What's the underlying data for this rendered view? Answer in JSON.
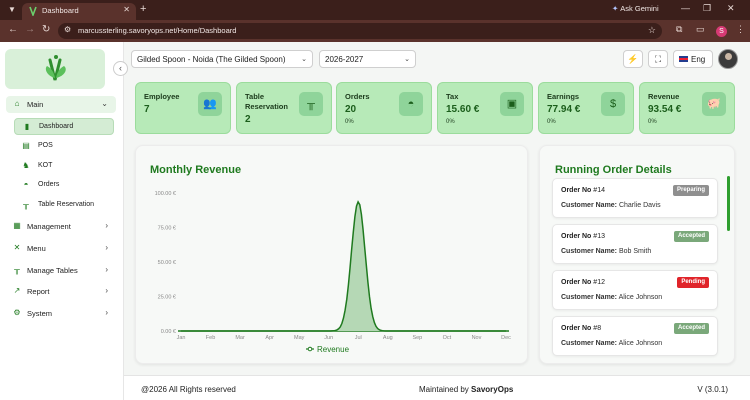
{
  "browser": {
    "tab_title": "Dashboard",
    "url": "marcussterling.savoryops.net/Home/Dashboard",
    "ask_gemini": "Ask Gemini",
    "profile_initial": "S"
  },
  "header": {
    "restaurant": "Gilded Spoon - Noida (The Gilded Spoon)",
    "year": "2026-2027",
    "language": "Eng"
  },
  "sidebar": {
    "main_label": "Main",
    "main_items": [
      {
        "label": "Dashboard",
        "icon": "bar-chart-icon"
      },
      {
        "label": "POS",
        "icon": "pos-icon"
      },
      {
        "label": "KOT",
        "icon": "chef-icon"
      },
      {
        "label": "Orders",
        "icon": "cloche-icon"
      },
      {
        "label": "Table Reservation",
        "icon": "table-icon"
      }
    ],
    "sections": [
      {
        "label": "Management",
        "icon": "management-icon"
      },
      {
        "label": "Menu",
        "icon": "cutlery-icon"
      },
      {
        "label": "Manage Tables",
        "icon": "table-icon"
      },
      {
        "label": "Report",
        "icon": "trend-icon"
      },
      {
        "label": "System",
        "icon": "gear-icon"
      }
    ]
  },
  "cards": [
    {
      "label": "Employee",
      "value": "7",
      "percent": "",
      "icon": "users-icon"
    },
    {
      "label": "Table Reservation",
      "value": "2",
      "percent": "",
      "icon": "table-icon"
    },
    {
      "label": "Orders",
      "value": "20",
      "percent": "0%",
      "icon": "cloche-icon"
    },
    {
      "label": "Tax",
      "value": "15.60 €",
      "percent": "0%",
      "icon": "money-icon"
    },
    {
      "label": "Earnings",
      "value": "77.94 €",
      "percent": "0%",
      "icon": "coin-icon"
    },
    {
      "label": "Revenue",
      "value": "93.54 €",
      "percent": "0%",
      "icon": "piggy-bank-icon"
    }
  ],
  "revenue": {
    "title": "Monthly Revenue",
    "chart_data": {
      "type": "area",
      "title": "Monthly Revenue",
      "categories": [
        "Jan",
        "Feb",
        "Mar",
        "Apr",
        "May",
        "Jun",
        "Jul",
        "Aug",
        "Sep",
        "Oct",
        "Nov",
        "Dec"
      ],
      "series": [
        {
          "name": "Revenue",
          "values": [
            0,
            0,
            0,
            0,
            0,
            0,
            93.54,
            0,
            0,
            0,
            0,
            0
          ]
        }
      ],
      "yticks": [
        "0.00 €",
        "25.00 €",
        "50.00 €",
        "75.00 €",
        "100.00 €"
      ],
      "ylim": [
        0,
        100
      ],
      "legend": "bottom",
      "line_color": "#1f7a1f",
      "fill_color": "#b5d8b5"
    }
  },
  "orders": {
    "title": "Running Order Details",
    "order_label": "Order No",
    "customer_label": "Customer Name:",
    "items": [
      {
        "number": "#14",
        "customer": "Charlie Davis",
        "status": "Preparing",
        "color": "#8f8f8f"
      },
      {
        "number": "#13",
        "customer": "Bob Smith",
        "status": "Accepted",
        "color": "#7aa87a"
      },
      {
        "number": "#12",
        "customer": "Alice Johnson",
        "status": "Pending",
        "color": "#e0242a"
      },
      {
        "number": "#8",
        "customer": "Alice Johnson",
        "status": "Accepted",
        "color": "#7aa87a"
      }
    ]
  },
  "footer": {
    "copyright": "@2026 All Rights reserved",
    "maintained_prefix": "Maintained by",
    "maintained_by": "SavoryOps",
    "version": "V (3.0.1)"
  }
}
